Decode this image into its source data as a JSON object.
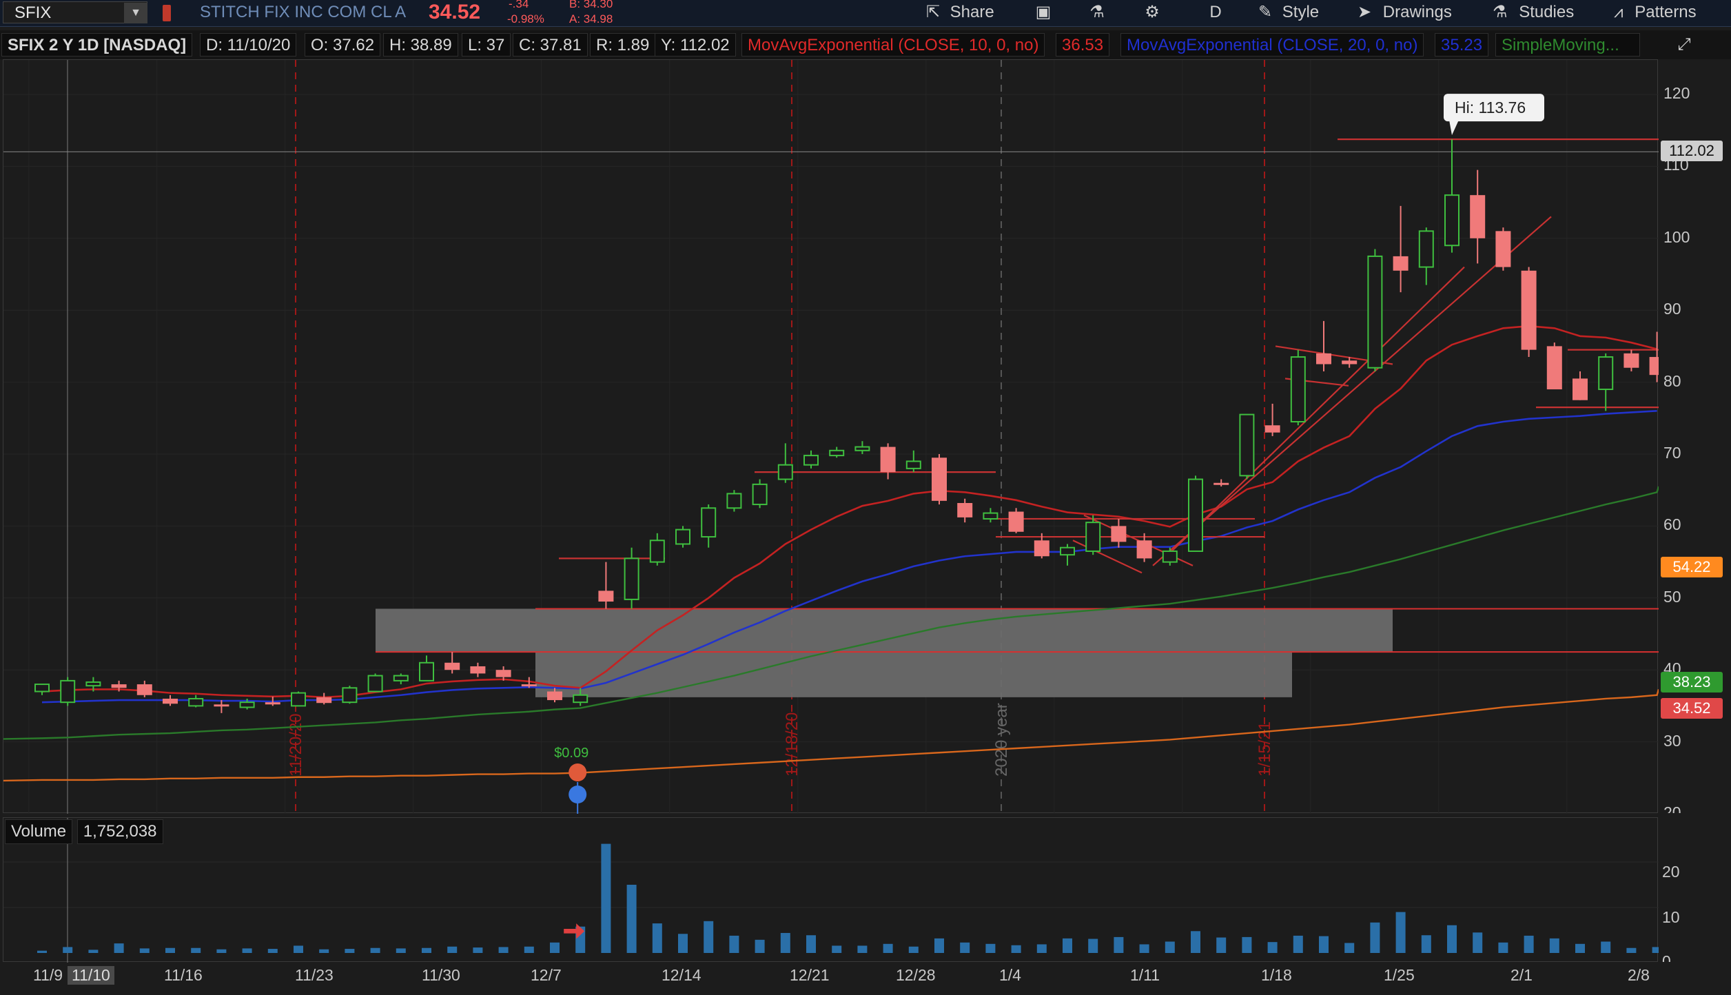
{
  "toolbar": {
    "symbol": "SFIX",
    "company": "STITCH FIX INC COM CL A",
    "last_price": "34.52",
    "net_change": "-.34",
    "pct_change": "-0.98%",
    "bid": "B: 34.30",
    "ask": "A: 34.98",
    "share_label": "Share",
    "timeframe_label": "D",
    "style_label": "Style",
    "drawings_label": "Drawings",
    "studies_label": "Studies",
    "patterns_label": "Patterns"
  },
  "infobar": {
    "title": "SFIX 2 Y 1D [NASDAQ]",
    "date": "D: 11/10/20",
    "open": "O: 37.62",
    "high": "H: 38.89",
    "low": "L: 37",
    "close": "C: 37.81",
    "range": "R: 1.89",
    "y_value": "Y: 112.02",
    "ema10": "MovAvgExponential (CLOSE, 10, 0, no)",
    "ema10_value": "36.53",
    "ema20": "MovAvgExponential (CLOSE, 20, 0, no)",
    "ema20_value": "35.23",
    "sma": "SimpleMoving..."
  },
  "price_axis": {
    "ticks": [
      "120",
      "110",
      "100",
      "90",
      "80",
      "70",
      "60",
      "50",
      "40",
      "30",
      "20"
    ],
    "tags": [
      {
        "label": "112.02",
        "color": "#cfcfcf"
      },
      {
        "label": "54.22",
        "color": "#ff8a1f"
      },
      {
        "label": "38.23",
        "color": "#2f9a2f"
      },
      {
        "label": "34.52",
        "color": "#e04848"
      }
    ]
  },
  "chart": {
    "hi_label": "Hi: 113.76",
    "earnings_label": "$0.09",
    "vertical_labels": [
      "11/20/20",
      "12/18/20",
      "2020 year",
      "1/15/21"
    ]
  },
  "volume": {
    "label": "Volume",
    "value": "1,752,038",
    "ticks": [
      "20",
      "10",
      "0"
    ]
  },
  "x_axis": {
    "dates": [
      "11/9",
      "11/10",
      "11/16",
      "11/23",
      "11/30",
      "12/7",
      "12/14",
      "12/21",
      "12/28",
      "1/4",
      "1/11",
      "1/18",
      "1/25",
      "2/1",
      "2/8"
    ]
  },
  "chart_data": {
    "type": "candlestick",
    "title": "SFIX 2 Y 1D [NASDAQ]",
    "ylim": [
      20,
      125
    ],
    "candles": [
      {
        "o": 37,
        "h": 38,
        "l": 36.5,
        "c": 38,
        "up": 1
      },
      {
        "o": 35.5,
        "h": 39,
        "l": 35,
        "c": 38.5,
        "up": 1
      },
      {
        "o": 37.8,
        "h": 39,
        "l": 37,
        "c": 38.3,
        "up": 1
      },
      {
        "o": 38,
        "h": 38.5,
        "l": 37,
        "c": 37.5,
        "up": 0
      },
      {
        "o": 38,
        "h": 38.5,
        "l": 36.2,
        "c": 36.5,
        "up": 0
      },
      {
        "o": 36,
        "h": 36.5,
        "l": 35,
        "c": 35.3,
        "up": 0
      },
      {
        "o": 35,
        "h": 36.5,
        "l": 34.8,
        "c": 36,
        "up": 1
      },
      {
        "o": 35.2,
        "h": 35.8,
        "l": 34,
        "c": 35,
        "up": 0
      },
      {
        "o": 34.8,
        "h": 36,
        "l": 34.5,
        "c": 35.5,
        "up": 1
      },
      {
        "o": 35.5,
        "h": 36.3,
        "l": 35,
        "c": 35.2,
        "up": 0
      },
      {
        "o": 35,
        "h": 37,
        "l": 35,
        "c": 36.8,
        "up": 1
      },
      {
        "o": 36.2,
        "h": 36.8,
        "l": 35.2,
        "c": 35.4,
        "up": 0
      },
      {
        "o": 35.5,
        "h": 37.8,
        "l": 35.3,
        "c": 37.5,
        "up": 1
      },
      {
        "o": 37,
        "h": 39.5,
        "l": 37,
        "c": 39.2,
        "up": 1
      },
      {
        "o": 38.5,
        "h": 39.5,
        "l": 38,
        "c": 39.2,
        "up": 1
      },
      {
        "o": 38.5,
        "h": 42,
        "l": 38.5,
        "c": 41,
        "up": 1
      },
      {
        "o": 41,
        "h": 42.5,
        "l": 39.5,
        "c": 40,
        "up": 0
      },
      {
        "o": 40.5,
        "h": 41,
        "l": 39,
        "c": 39.5,
        "up": 0
      },
      {
        "o": 40,
        "h": 40.5,
        "l": 38.5,
        "c": 39,
        "up": 0
      },
      {
        "o": 38,
        "h": 39,
        "l": 37.5,
        "c": 37.8,
        "up": 0
      },
      {
        "o": 37,
        "h": 37.5,
        "l": 35.5,
        "c": 35.8,
        "up": 0
      },
      {
        "o": 35.5,
        "h": 37.5,
        "l": 35,
        "c": 36.5,
        "up": 1
      },
      {
        "o": 51,
        "h": 55,
        "l": 48.5,
        "c": 49.5,
        "up": 0
      },
      {
        "o": 49.8,
        "h": 57,
        "l": 48.5,
        "c": 55.5,
        "up": 1
      },
      {
        "o": 55,
        "h": 59,
        "l": 54.5,
        "c": 58,
        "up": 1
      },
      {
        "o": 57.5,
        "h": 60,
        "l": 57,
        "c": 59.5,
        "up": 1
      },
      {
        "o": 58.5,
        "h": 63,
        "l": 57,
        "c": 62.5,
        "up": 1
      },
      {
        "o": 62.5,
        "h": 65,
        "l": 62,
        "c": 64.5,
        "up": 1
      },
      {
        "o": 63,
        "h": 66.5,
        "l": 62.5,
        "c": 65.8,
        "up": 1
      },
      {
        "o": 66.5,
        "h": 71.5,
        "l": 66,
        "c": 68.5,
        "up": 1
      },
      {
        "o": 68.5,
        "h": 70.5,
        "l": 68,
        "c": 69.8,
        "up": 1
      },
      {
        "o": 69.8,
        "h": 71,
        "l": 69.5,
        "c": 70.5,
        "up": 1
      },
      {
        "o": 70.5,
        "h": 71.8,
        "l": 70,
        "c": 71,
        "up": 1
      },
      {
        "o": 71,
        "h": 71.5,
        "l": 66.5,
        "c": 67.5,
        "up": 0
      },
      {
        "o": 68,
        "h": 70.5,
        "l": 67.5,
        "c": 69,
        "up": 1
      },
      {
        "o": 69.5,
        "h": 70,
        "l": 63,
        "c": 63.5,
        "up": 0
      },
      {
        "o": 63.2,
        "h": 63.8,
        "l": 60.5,
        "c": 61.2,
        "up": 0
      },
      {
        "o": 61,
        "h": 62.5,
        "l": 60.5,
        "c": 61.8,
        "up": 1
      },
      {
        "o": 62,
        "h": 62.5,
        "l": 59,
        "c": 59.2,
        "up": 0
      },
      {
        "o": 58,
        "h": 59,
        "l": 55.5,
        "c": 55.8,
        "up": 0
      },
      {
        "o": 56,
        "h": 57.5,
        "l": 54.5,
        "c": 57,
        "up": 1
      },
      {
        "o": 56.5,
        "h": 61.5,
        "l": 56,
        "c": 60.5,
        "up": 1
      },
      {
        "o": 60,
        "h": 61,
        "l": 57,
        "c": 57.8,
        "up": 0
      },
      {
        "o": 58,
        "h": 59,
        "l": 55,
        "c": 55.5,
        "up": 0
      },
      {
        "o": 55,
        "h": 57,
        "l": 54.5,
        "c": 56.5,
        "up": 1
      },
      {
        "o": 56.5,
        "h": 67,
        "l": 56.5,
        "c": 66.5,
        "up": 1
      },
      {
        "o": 66,
        "h": 66.5,
        "l": 65.5,
        "c": 66,
        "up": 0
      },
      {
        "o": 67,
        "h": 75.5,
        "l": 66.5,
        "c": 75.5,
        "up": 1
      },
      {
        "o": 74,
        "h": 77,
        "l": 72.5,
        "c": 73,
        "up": 0
      },
      {
        "o": 74.5,
        "h": 84.5,
        "l": 74,
        "c": 83.5,
        "up": 1
      },
      {
        "o": 84,
        "h": 88.5,
        "l": 81.5,
        "c": 82.5,
        "up": 0
      },
      {
        "o": 83,
        "h": 83.5,
        "l": 82,
        "c": 82.5,
        "up": 0
      },
      {
        "o": 82,
        "h": 98.5,
        "l": 81.5,
        "c": 97.5,
        "up": 1
      },
      {
        "o": 97.5,
        "h": 104.5,
        "l": 92.5,
        "c": 95.5,
        "up": 0
      },
      {
        "o": 96,
        "h": 101.5,
        "l": 93.5,
        "c": 101,
        "up": 1
      },
      {
        "o": 99,
        "h": 113.76,
        "l": 98,
        "c": 106,
        "up": 1
      },
      {
        "o": 106,
        "h": 109.5,
        "l": 96.5,
        "c": 100,
        "up": 0
      },
      {
        "o": 101,
        "h": 101.5,
        "l": 95.5,
        "c": 96,
        "up": 0
      },
      {
        "o": 95.5,
        "h": 96,
        "l": 83.5,
        "c": 84.5,
        "up": 0
      },
      {
        "o": 85,
        "h": 85.5,
        "l": 79,
        "c": 79,
        "up": 0
      },
      {
        "o": 80.5,
        "h": 81.5,
        "l": 77.5,
        "c": 77.5,
        "up": 0
      },
      {
        "o": 79,
        "h": 84,
        "l": 76,
        "c": 83.5,
        "up": 1
      },
      {
        "o": 84,
        "h": 84.5,
        "l": 81.5,
        "c": 82,
        "up": 0
      },
      {
        "o": 83.5,
        "h": 87,
        "l": 80,
        "c": 81,
        "up": 0
      }
    ],
    "ema10": [
      37,
      37.2,
      37.3,
      37.3,
      37.1,
      36.8,
      36.7,
      36.5,
      36.4,
      36.3,
      36.4,
      36.2,
      36.4,
      36.9,
      37.3,
      38.1,
      38.4,
      38.6,
      38.7,
      38.4,
      37.8,
      37.5,
      39.8,
      42.7,
      45.5,
      47.6,
      50,
      52.8,
      54.8,
      57.5,
      59.5,
      61.3,
      62.8,
      63.5,
      64.5,
      64.9,
      64.7,
      64.2,
      63.6,
      62.7,
      61.9,
      61.6,
      61.3,
      60.7,
      59.9,
      61.6,
      62.7,
      65.1,
      66.1,
      69,
      70.9,
      72.5,
      76.3,
      79.1,
      83,
      85.2,
      86.4,
      87.5,
      87.8,
      87.5,
      86.4,
      86.2,
      85.5,
      84.6
    ],
    "ema20": [
      35.5,
      35.6,
      35.7,
      35.8,
      35.8,
      35.8,
      35.8,
      35.7,
      35.7,
      35.6,
      35.8,
      35.8,
      35.9,
      36.2,
      36.5,
      36.9,
      37.2,
      37.4,
      37.5,
      37.6,
      37.5,
      37.4,
      38.2,
      39.5,
      40.8,
      42.1,
      43.6,
      45.2,
      46.6,
      48.2,
      49.6,
      51,
      52.3,
      53.3,
      54.4,
      55.2,
      55.8,
      56.1,
      56.4,
      56.4,
      56.4,
      56.8,
      57.1,
      57.1,
      57.1,
      57.9,
      58.6,
      59.8,
      60.7,
      62.3,
      63.6,
      64.7,
      66.7,
      68.2,
      70.4,
      72.5,
      73.9,
      74.5,
      74.9,
      75.1,
      75.3,
      75.6,
      75.8,
      76
    ],
    "sma50": [
      30.5,
      30.6,
      30.8,
      31,
      31.1,
      31.2,
      31.4,
      31.6,
      31.7,
      31.9,
      32.1,
      32.3,
      32.5,
      32.7,
      33,
      33.2,
      33.5,
      33.8,
      34,
      34.2,
      34.5,
      34.7,
      35.4,
      36.1,
      36.8,
      37.6,
      38.4,
      39.2,
      40.1,
      41,
      41.9,
      42.7,
      43.5,
      44.3,
      45.1,
      45.9,
      46.5,
      47,
      47.4,
      47.7,
      48,
      48.3,
      48.6,
      48.9,
      49.2,
      49.7,
      50.2,
      50.8,
      51.4,
      52.1,
      52.9,
      53.6,
      54.5,
      55.4,
      56.4,
      57.4,
      58.4,
      59.4,
      60.3,
      61.2,
      62.1,
      63,
      63.8,
      64.7
    ],
    "sma200": [
      24.7,
      24.7,
      24.7,
      24.8,
      24.8,
      24.9,
      24.9,
      25,
      25,
      25,
      25.1,
      25.1,
      25.2,
      25.2,
      25.3,
      25.3,
      25.4,
      25.5,
      25.5,
      25.6,
      25.6,
      25.7,
      25.9,
      26.1,
      26.3,
      26.5,
      26.7,
      26.9,
      27.1,
      27.3,
      27.5,
      27.7,
      27.9,
      28.1,
      28.3,
      28.5,
      28.7,
      28.9,
      29.1,
      29.3,
      29.5,
      29.7,
      29.9,
      30.1,
      30.3,
      30.6,
      30.9,
      31.2,
      31.5,
      31.8,
      32.1,
      32.4,
      32.8,
      33.2,
      33.6,
      34,
      34.4,
      34.8,
      35.1,
      35.4,
      35.7,
      36,
      36.2,
      36.5
    ],
    "volume": [
      0.5,
      1.3,
      0.7,
      2.1,
      1,
      1.1,
      1.1,
      0.8,
      1,
      0.9,
      1.6,
      0.8,
      0.9,
      1.1,
      1,
      1.1,
      1.4,
      1.2,
      1.3,
      1.4,
      2.3,
      5.8,
      24,
      15,
      6.5,
      4.2,
      7,
      3.8,
      2.9,
      4.4,
      3.9,
      1.6,
      1.6,
      2,
      1.4,
      3.2,
      2.3,
      2,
      1.7,
      1.9,
      3.2,
      3.1,
      3.5,
      1.9,
      2.5,
      4.8,
      3.4,
      3.5,
      2.4,
      3.8,
      3.7,
      2.2,
      6.7,
      9,
      3.9,
      6.1,
      4.5,
      2.3,
      3.8,
      3.2,
      2,
      2.5,
      1.1,
      1.3
    ]
  }
}
